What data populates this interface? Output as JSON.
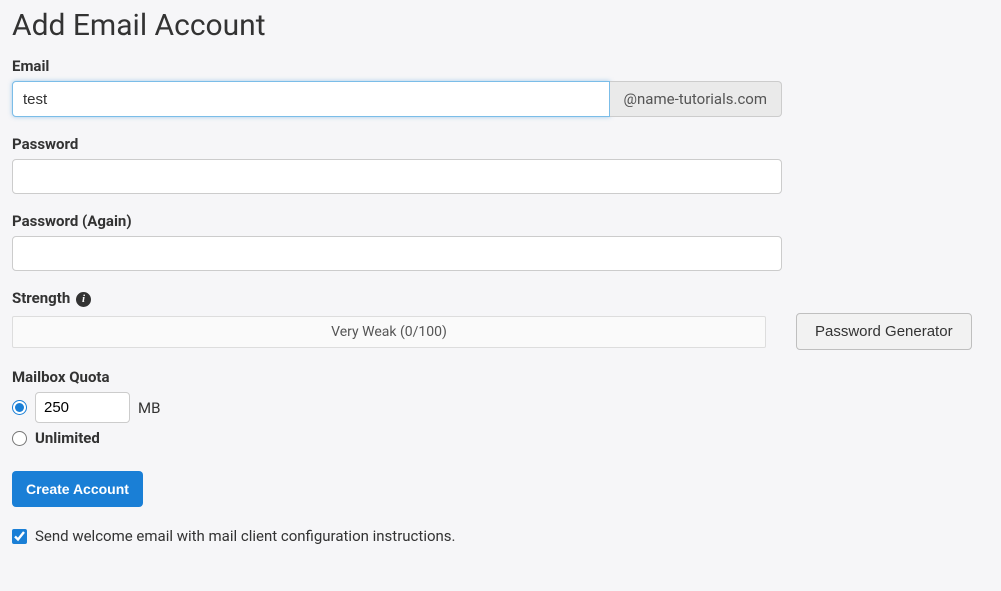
{
  "page_title": "Add Email Account",
  "email": {
    "label": "Email",
    "value": "test",
    "domain_suffix": "@name-tutorials.com"
  },
  "password": {
    "label": "Password",
    "value": ""
  },
  "password_again": {
    "label": "Password (Again)",
    "value": ""
  },
  "strength": {
    "label": "Strength",
    "meter_text": "Very Weak (0/100)"
  },
  "password_generator_label": "Password Generator",
  "quota": {
    "label": "Mailbox Quota",
    "size_value": "250",
    "unit": "MB",
    "unlimited_label": "Unlimited",
    "custom_checked": true,
    "unlimited_checked": false
  },
  "create_button_label": "Create Account",
  "welcome_checkbox": {
    "checked": true,
    "label": "Send welcome email with mail client configuration instructions."
  }
}
